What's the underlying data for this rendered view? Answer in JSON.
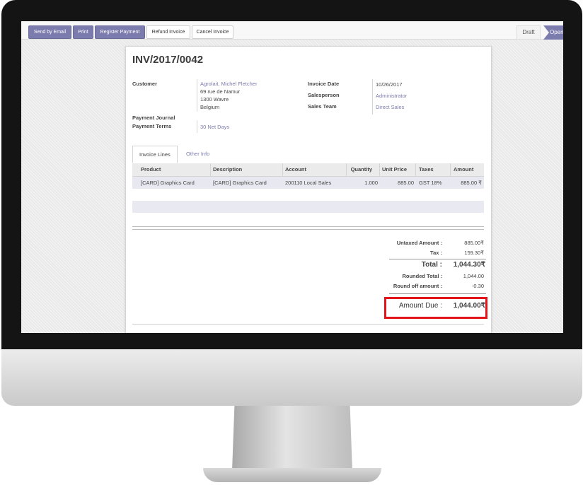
{
  "toolbar": {
    "send_by_email": "Send by Email",
    "print": "Print",
    "register_payment": "Register Payment",
    "refund_invoice": "Refund Invoice",
    "cancel_invoice": "Cancel Invoice"
  },
  "status": {
    "draft": "Draft",
    "open": "Open"
  },
  "invoice": {
    "number": "INV/2017/0042",
    "customer_label": "Customer",
    "customer_name": "Agrolait, Michel Fletcher",
    "address_line1": "69 rue de Namur",
    "address_line2": "1300 Wavre",
    "address_line3": "Belgium",
    "payment_journal_label": "Payment Journal",
    "payment_terms_label": "Payment Terms",
    "payment_terms_value": "30 Net Days",
    "invoice_date_label": "Invoice Date",
    "invoice_date_value": "10/26/2017",
    "salesperson_label": "Salesperson",
    "salesperson_value": "Administrator",
    "sales_team_label": "Sales Team",
    "sales_team_value": "Direct Sales"
  },
  "tabs": {
    "invoice_lines": "Invoice Lines",
    "other_info": "Other Info"
  },
  "lines": {
    "headers": {
      "product": "Product",
      "description": "Description",
      "account": "Account",
      "quantity": "Quantity",
      "unit_price": "Unit Price",
      "taxes": "Taxes",
      "amount": "Amount"
    },
    "rows": [
      {
        "product": "[CARD] Graphics Card",
        "description": "[CARD] Graphics Card",
        "account": "200110 Local Sales",
        "quantity": "1.000",
        "unit_price": "885.00",
        "taxes": "GST 18%",
        "amount": "885.00 ₹"
      }
    ]
  },
  "totals": {
    "untaxed_label": "Untaxed Amount :",
    "untaxed_value": "885.00₹",
    "tax_label": "Tax :",
    "tax_value": "159.30₹",
    "total_label": "Total :",
    "total_value": "1,044.30₹",
    "rounded_label": "Rounded Total :",
    "rounded_value": "1,044.00",
    "round_off_label": "Round off amount :",
    "round_off_value": "-0.30",
    "amount_due_label": "Amount Due :",
    "amount_due_value": "1,044.00₹"
  },
  "colors": {
    "primary": "#7c7bad",
    "highlight": "#e3141a"
  }
}
